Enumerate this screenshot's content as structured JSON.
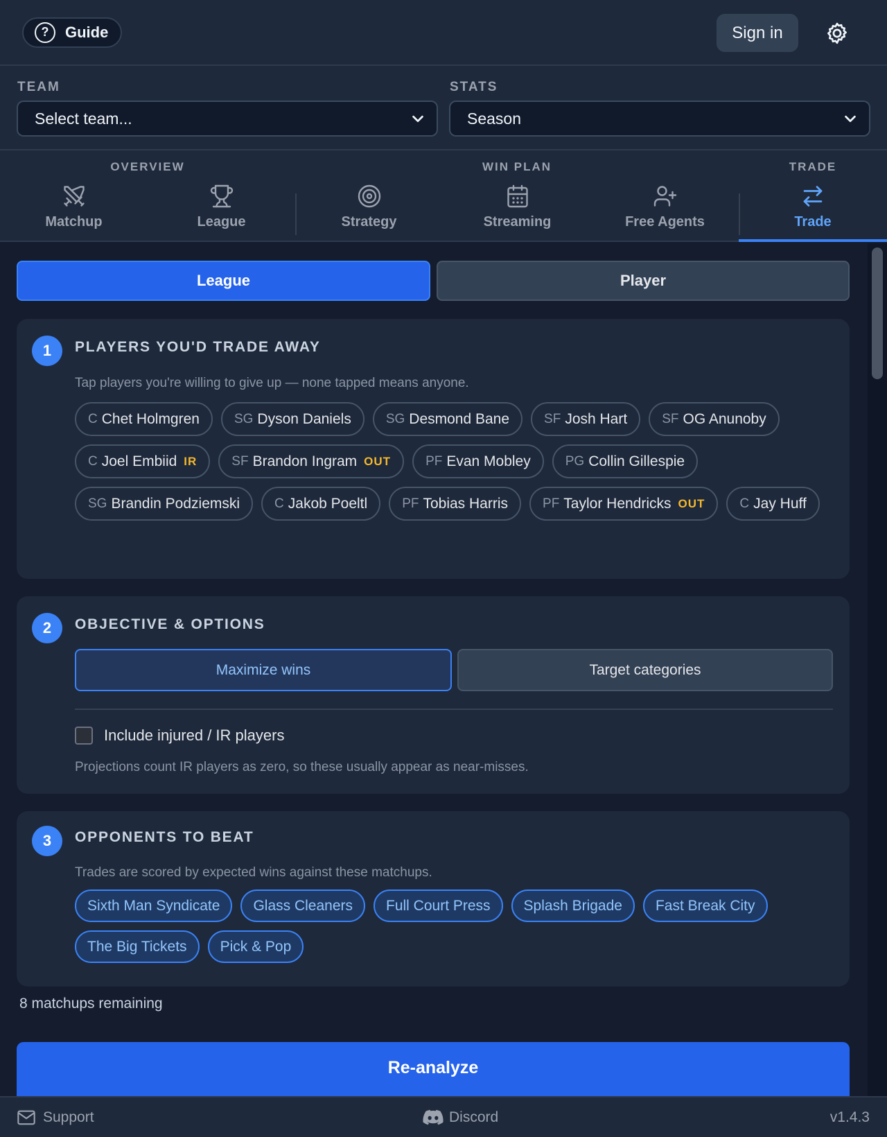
{
  "topbar": {
    "guide_label": "Guide",
    "signin_label": "Sign in"
  },
  "selectors": {
    "team_label": "TEAM",
    "team_placeholder": "Select team...",
    "stats_label": "STATS",
    "stats_value": "Season"
  },
  "nav": {
    "groups": [
      "OVERVIEW",
      "WIN PLAN",
      "TRADE"
    ],
    "tabs": [
      "Matchup",
      "League",
      "Strategy",
      "Streaming",
      "Free Agents",
      "Trade"
    ],
    "active_tab": "Trade",
    "accent_color": "#3b82f6"
  },
  "mode": {
    "league_label": "League",
    "player_label": "Player",
    "active": "League"
  },
  "section1": {
    "step": "1",
    "title": "PLAYERS YOU'D TRADE AWAY",
    "description": "Tap players you're willing to give up — none tapped means anyone.",
    "players": [
      {
        "pos": "C",
        "name": "Chet Holmgren",
        "tag": ""
      },
      {
        "pos": "SG",
        "name": "Dyson Daniels",
        "tag": ""
      },
      {
        "pos": "SG",
        "name": "Desmond Bane",
        "tag": ""
      },
      {
        "pos": "SF",
        "name": "Josh Hart",
        "tag": ""
      },
      {
        "pos": "SF",
        "name": "OG Anunoby",
        "tag": ""
      },
      {
        "pos": "C",
        "name": "Joel Embiid",
        "tag": "IR"
      },
      {
        "pos": "SF",
        "name": "Brandon Ingram",
        "tag": "OUT"
      },
      {
        "pos": "PF",
        "name": "Evan Mobley",
        "tag": ""
      },
      {
        "pos": "PG",
        "name": "Collin Gillespie",
        "tag": ""
      },
      {
        "pos": "SG",
        "name": "Brandin Podziemski",
        "tag": ""
      },
      {
        "pos": "C",
        "name": "Jakob Poeltl",
        "tag": ""
      },
      {
        "pos": "PF",
        "name": "Tobias Harris",
        "tag": ""
      },
      {
        "pos": "PF",
        "name": "Taylor Hendricks",
        "tag": "OUT"
      },
      {
        "pos": "C",
        "name": "Jay Huff",
        "tag": ""
      }
    ]
  },
  "section2": {
    "step": "2",
    "title": "OBJECTIVE & OPTIONS",
    "objective_primary": "Maximize wins",
    "objective_secondary": "Target categories",
    "include_injured_label": "Include injured / IR players",
    "include_injured_checked": false,
    "note": "Projections count IR players as zero, so these usually appear as near-misses."
  },
  "section3": {
    "step": "3",
    "title": "OPPONENTS TO BEAT",
    "description": "Trades are scored by expected wins against these matchups.",
    "opponents": [
      "Sixth Man Syndicate",
      "Glass Cleaners",
      "Full Court Press",
      "Splash Brigade",
      "Fast Break City",
      "The Big Tickets",
      "Pick & Pop"
    ]
  },
  "remaining_label": "8 matchups remaining",
  "reanalyze_label": "Re-analyze",
  "footer": {
    "support_label": "Support",
    "discord_label": "Discord",
    "version": "v1.4.3"
  }
}
